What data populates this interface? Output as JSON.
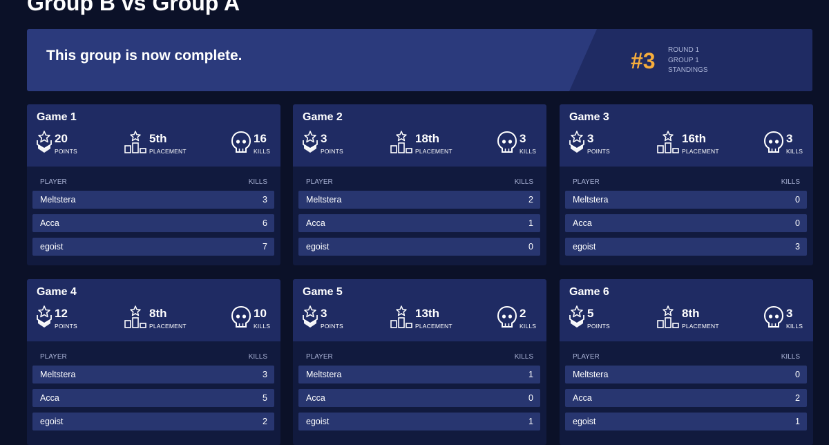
{
  "page": {
    "title": "Group B vs Group A"
  },
  "banner": {
    "message": "This group is now complete.",
    "rank": "#3",
    "meta": [
      "ROUND 1",
      "GROUP 1",
      "STANDINGS"
    ]
  },
  "table_headers": {
    "player": "PLAYER",
    "kills": "KILLS"
  },
  "stat_labels": {
    "points": "POINTS",
    "placement": "PLACEMENT",
    "kills": "KILLS"
  },
  "colors": {
    "accent_rank": "#f6ad3c",
    "banner": "#2b3a7c",
    "card_header": "#1f2b63",
    "row": "#283670",
    "background": "#0b1128"
  },
  "games": [
    {
      "title": "Game 1",
      "points": "20",
      "placement": "5th",
      "kills": "16",
      "players": [
        {
          "name": "Meltstera",
          "kills": "3"
        },
        {
          "name": "Acca",
          "kills": "6"
        },
        {
          "name": "egoist",
          "kills": "7"
        }
      ]
    },
    {
      "title": "Game 2",
      "points": "3",
      "placement": "18th",
      "kills": "3",
      "players": [
        {
          "name": "Meltstera",
          "kills": "2"
        },
        {
          "name": "Acca",
          "kills": "1"
        },
        {
          "name": "egoist",
          "kills": "0"
        }
      ]
    },
    {
      "title": "Game 3",
      "points": "3",
      "placement": "16th",
      "kills": "3",
      "players": [
        {
          "name": "Meltstera",
          "kills": "0"
        },
        {
          "name": "Acca",
          "kills": "0"
        },
        {
          "name": "egoist",
          "kills": "3"
        }
      ]
    },
    {
      "title": "Game 4",
      "points": "12",
      "placement": "8th",
      "kills": "10",
      "players": [
        {
          "name": "Meltstera",
          "kills": "3"
        },
        {
          "name": "Acca",
          "kills": "5"
        },
        {
          "name": "egoist",
          "kills": "2"
        }
      ]
    },
    {
      "title": "Game 5",
      "points": "3",
      "placement": "13th",
      "kills": "2",
      "players": [
        {
          "name": "Meltstera",
          "kills": "1"
        },
        {
          "name": "Acca",
          "kills": "0"
        },
        {
          "name": "egoist",
          "kills": "1"
        }
      ]
    },
    {
      "title": "Game 6",
      "points": "5",
      "placement": "8th",
      "kills": "3",
      "players": [
        {
          "name": "Meltstera",
          "kills": "0"
        },
        {
          "name": "Acca",
          "kills": "2"
        },
        {
          "name": "egoist",
          "kills": "1"
        }
      ]
    }
  ],
  "icons": {
    "points": "rank-chevron-star-icon",
    "placement": "podium-star-icon",
    "kills": "skull-icon"
  }
}
